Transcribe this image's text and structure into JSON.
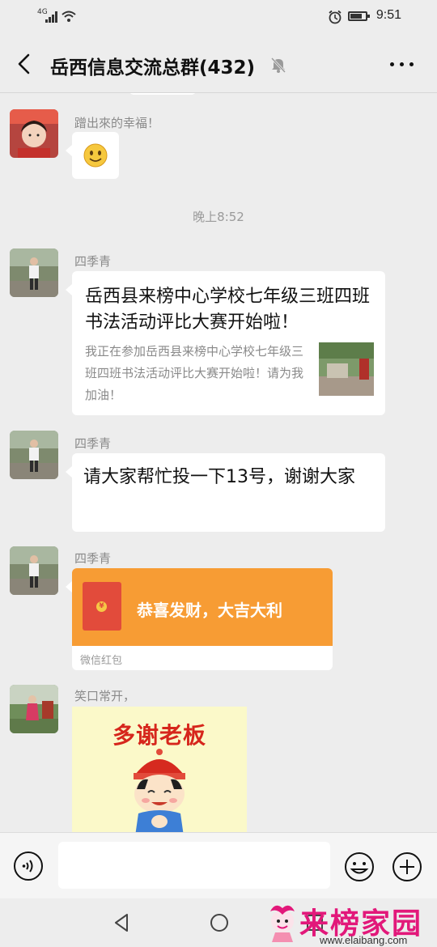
{
  "status_bar": {
    "network": "4G",
    "time": "9:51"
  },
  "header": {
    "title": "岳西信息交流总群(432)"
  },
  "messages": [
    {
      "sender": "蹭出來的幸福！",
      "type": "emoji"
    },
    {
      "type": "time",
      "text": "晚上8:52"
    },
    {
      "sender": "四季青",
      "type": "link",
      "title": "岳西县来榜中心学校七年级三班四班书法活动评比大赛开始啦！",
      "desc": "我正在参加岳西县来榜中心学校七年级三班四班书法活动评比大赛开始啦！请为我加油！"
    },
    {
      "sender": "四季青",
      "type": "text",
      "text": "请大家帮忙投一下13号，谢谢大家"
    },
    {
      "sender": "四季青",
      "type": "red_packet",
      "text": "恭喜发财，大吉大利",
      "footer": "微信红包"
    },
    {
      "sender": "笑口常开，",
      "type": "sticker",
      "text": "多谢老板"
    }
  ],
  "input": {
    "value": ""
  },
  "watermark": {
    "text": "来榜家园",
    "url": "www.elaibang.com"
  },
  "colors": {
    "red_packet": "#f79c34",
    "watermark": "#e2187a",
    "background": "#ededed"
  }
}
